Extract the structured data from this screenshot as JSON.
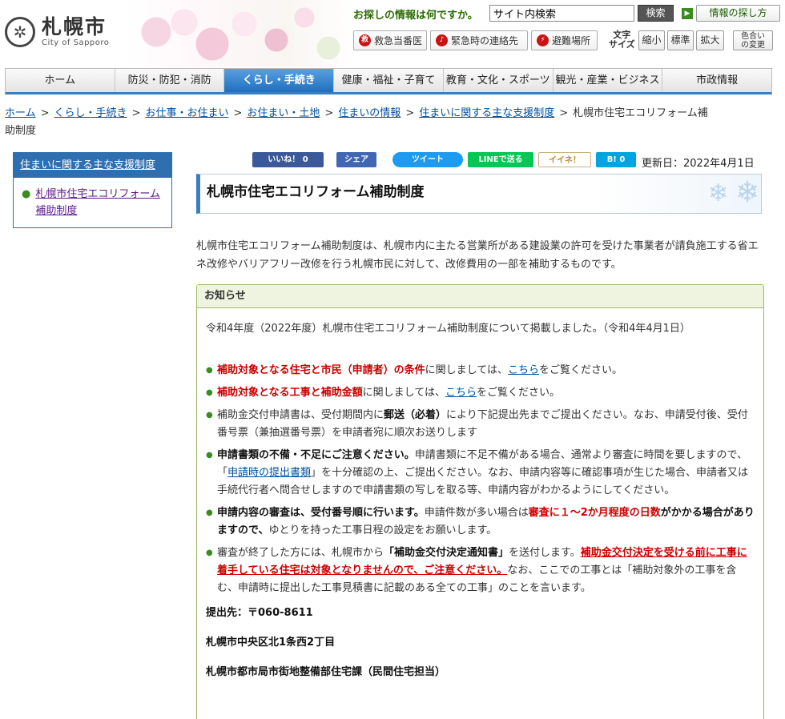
{
  "header": {
    "logo_jp": "札幌市",
    "logo_en": "City of Sapporo",
    "search_label": "お探しの情報は何ですか。",
    "search_value": "サイト内検索",
    "search_button": "検索",
    "howto_button": "情報の探し方",
    "emergency": [
      {
        "icon": "救",
        "label": "救急当番医"
      },
      {
        "icon": "♪",
        "label": "緊急時の連絡先"
      },
      {
        "icon": "⚡",
        "label": "避難場所"
      }
    ],
    "fontsize_label_1": "文字",
    "fontsize_label_2": "サイズ",
    "font_small": "縮小",
    "font_normal": "標準",
    "font_large": "拡大",
    "color_line1": "色合い",
    "color_line2": "の変更"
  },
  "nav": {
    "items": [
      "ホーム",
      "防災・防犯・消防",
      "くらし・手続き",
      "健康・福祉・子育て",
      "教育・文化・スポーツ",
      "観光・産業・ビジネス",
      "市政情報"
    ],
    "active_index": 2
  },
  "breadcrumb": {
    "links": [
      "ホーム",
      "くらし・手続き",
      "お仕事・お住まい",
      "お住まい・土地",
      "住まいの情報",
      "住まいに関する主な支援制度"
    ],
    "current_line1": "札幌市住宅エコリフォーム補",
    "current_line2": "助制度"
  },
  "sidebar": {
    "heading": "住まいに関する主な支援制度",
    "item": "札幌市住宅エコリフォーム補助制度"
  },
  "social": {
    "like": "いいね！ 0",
    "share": "シェア",
    "tweet": "ツイート",
    "line": "LINEで送る",
    "mixi": "イイネ！",
    "hatena": "B! 0",
    "update": "更新日：2022年4月1日"
  },
  "page": {
    "title": "札幌市住宅エコリフォーム補助制度",
    "intro": "札幌市住宅エコリフォーム補助制度は、札幌市内に主たる営業所がある建設業の許可を受けた事業者が請負施工する省エネ改修やバリアフリー改修を行う札幌市民に対して、改修費用の一部を補助するものです。"
  },
  "notice": {
    "heading": "お知らせ",
    "lead": "令和4年度（2022年度）札幌市住宅エコリフォーム補助制度について掲載しました。（令和4年4月1日）",
    "b1_red": "補助対象となる住宅と市民（申請者）の条件",
    "b1_mid": "に関しましては、",
    "b1_link": "こちら",
    "b1_end": "をご覧ください。",
    "b2_red": "補助対象となる工事と補助金額",
    "b2_mid": "に関しましては、",
    "b2_link": "こちら",
    "b2_end": "をご覧ください。",
    "b3_a": "補助金交付申請書は、受付期間内に",
    "b3_bold": "郵送（必着）",
    "b3_b": "により下記提出先までご提出ください。なお、申請受付後、受付番号票（兼抽選番号票）を申請者宛に順次お送りします",
    "b4_bold": "申請書類の不備・不足にご注意ください。",
    "b4_a": "申請書類に不足不備がある場合、通常より審査に時間を要しますので、「",
    "b4_link": "申請時の提出書類",
    "b4_b": "」を十分確認の上、ご提出ください。なお、申請内容等に確認事項が生じた場合、申請者又は手続代行者へ問合せしますので申請書類の写しを取る等、申請内容がわかるようにしてください。",
    "b5_bold": "申請内容の審査は、受付番号順に行います。",
    "b5_a": "申請件数が多い場合は",
    "b5_red": "審査に１～2か月程度の日数",
    "b5_bold2": "がかかる場合がありますので、",
    "b5_b": "ゆとりを持った工事日程の設定をお願いします。",
    "b6_a": "審査が終了した方には、札幌市から",
    "b6_bold": "「補助金交付決定通知書」",
    "b6_b": "を送付します。",
    "b6_red": "補助金交付決定を受ける前に工事に着手している住宅は対象となりませんので、ご注意ください。",
    "b6_c": "なお、ここでの工事とは「補助対象外の工事を含む、申請時に提出した工事見積書に記載のある全ての工事」のことを言います。",
    "addr1": "提出先：〒060-8611",
    "addr2": "札幌市中央区北1条西2丁目",
    "addr3": "札幌市都市局市街地整備部住宅課（民間住宅担当）"
  },
  "colors": {
    "accent": "#2f6fb0",
    "green": "#3b8b1e",
    "red": "#cc0000"
  }
}
